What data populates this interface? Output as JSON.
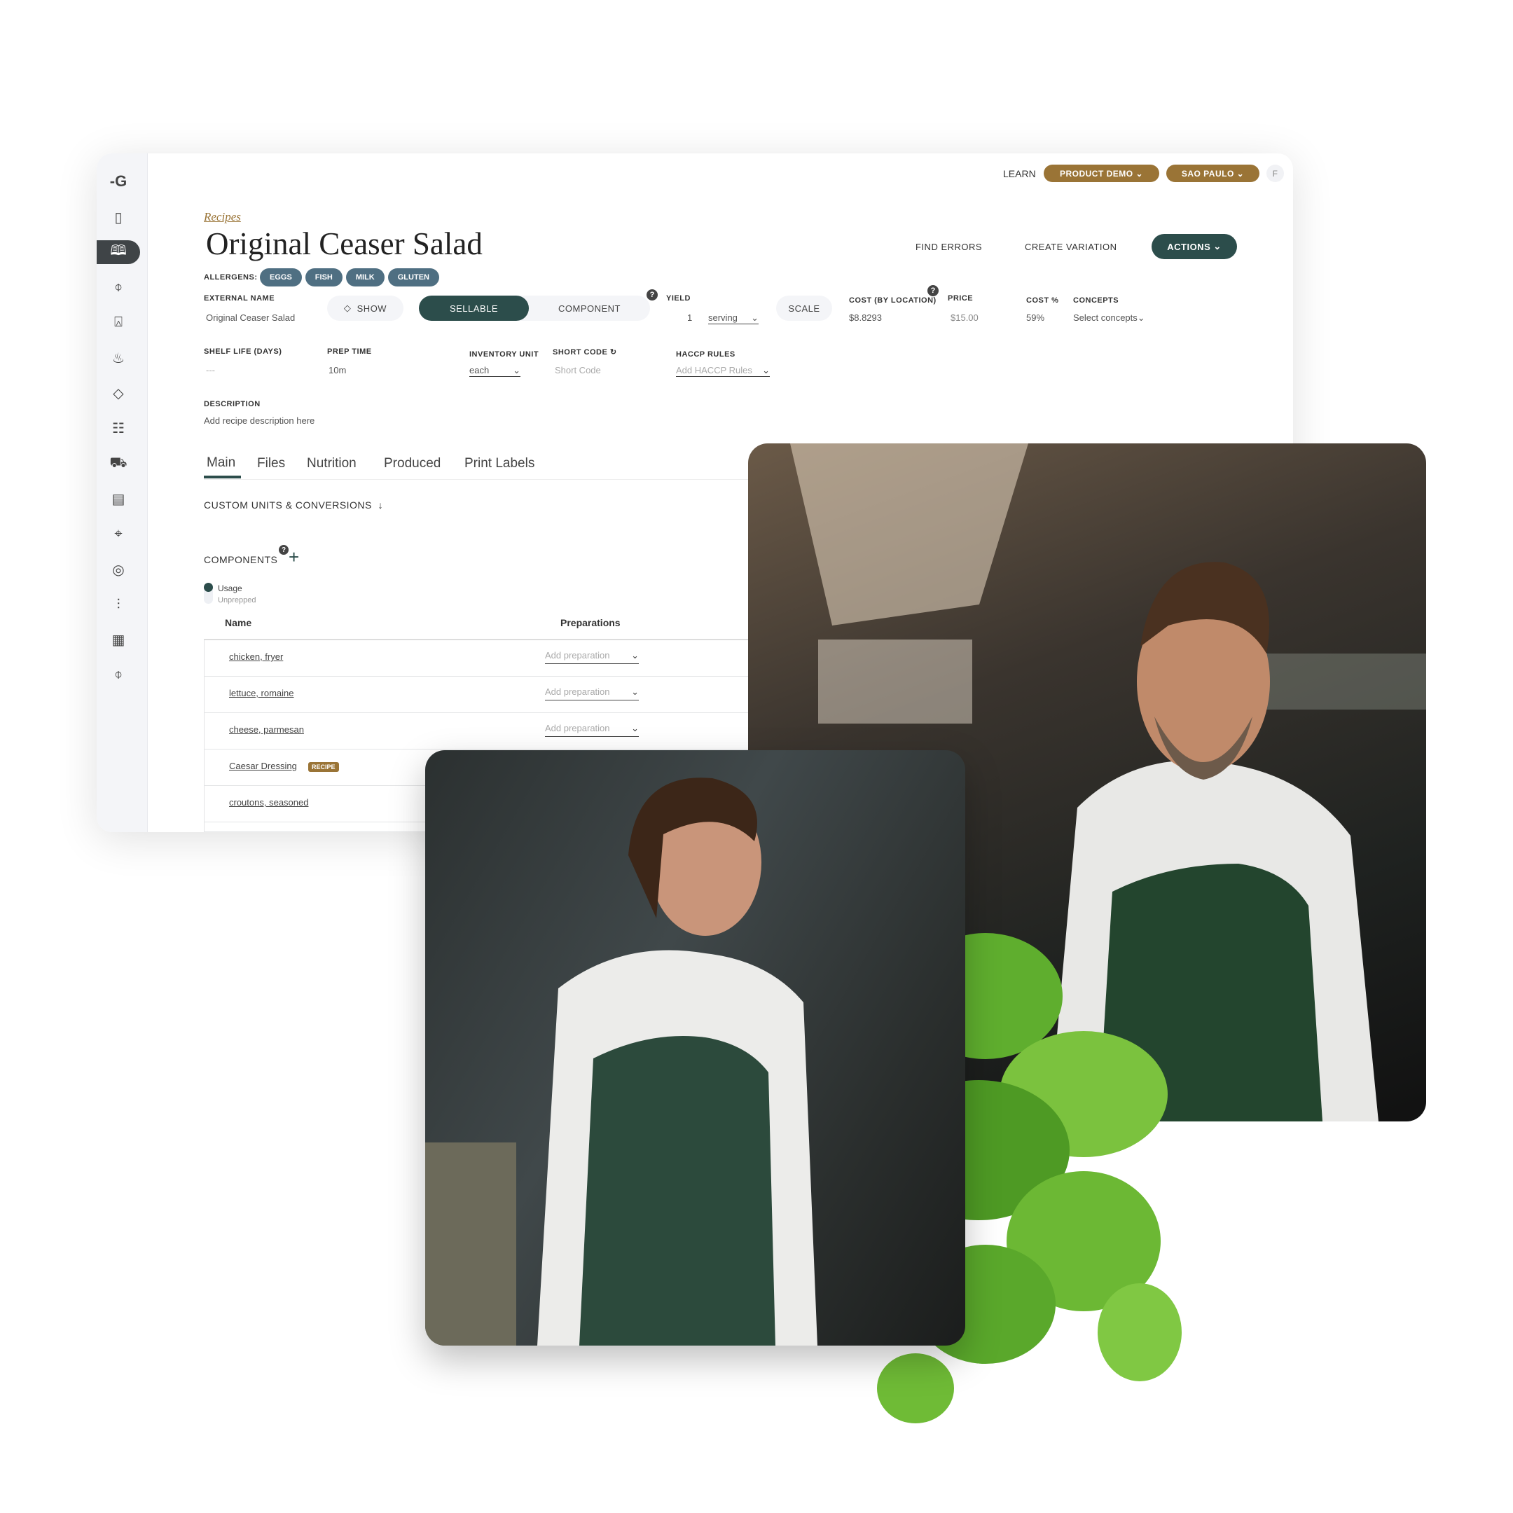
{
  "topbar": {
    "learn": "LEARN",
    "product_demo": "PRODUCT DEMO",
    "location": "SAO PAULO",
    "avatar": "F"
  },
  "breadcrumb": "Recipes",
  "title": "Original Ceaser Salad",
  "header_actions": {
    "find_errors": "FIND ERRORS",
    "create_variation": "CREATE VARIATION",
    "actions": "ACTIONS"
  },
  "allergens": {
    "label": "ALLERGENS:",
    "items": [
      "EGGS",
      "FISH",
      "MILK",
      "GLUTEN"
    ]
  },
  "fields": {
    "external_name": {
      "label": "EXTERNAL NAME",
      "value": "Original Ceaser Salad"
    },
    "show": "SHOW",
    "toggle": {
      "selected": "SELLABLE",
      "other": "COMPONENT"
    },
    "yield": {
      "label": "YIELD",
      "qty": "1",
      "unit": "serving"
    },
    "scale": "SCALE",
    "cost": {
      "label": "COST (BY LOCATION)",
      "value": "$8.8293"
    },
    "price": {
      "label": "PRICE",
      "value": "$15.00"
    },
    "cost_pct": {
      "label": "COST %",
      "value": "59%"
    },
    "concepts": {
      "label": "CONCEPTS",
      "placeholder": "Select concepts"
    },
    "shelf_life": {
      "label": "SHELF LIFE (DAYS)",
      "value": "---"
    },
    "prep_time": {
      "label": "PREP TIME",
      "value": "10m"
    },
    "inventory_unit": {
      "label": "INVENTORY UNIT",
      "value": "each"
    },
    "short_code": {
      "label": "SHORT CODE",
      "placeholder": "Short Code"
    },
    "haccp": {
      "label": "HACCP RULES",
      "placeholder": "Add HACCP Rules"
    },
    "description": {
      "label": "DESCRIPTION",
      "placeholder": "Add recipe description here"
    }
  },
  "tabs": [
    "Main",
    "Files",
    "Nutrition",
    "Produced",
    "Print Labels"
  ],
  "active_tab": "Main",
  "custom_units": "CUSTOM UNITS & CONVERSIONS",
  "components": {
    "title": "COMPONENTS",
    "legend": [
      "Usage",
      "Unprepped"
    ],
    "columns": [
      "Name",
      "Preparations"
    ],
    "rows": [
      {
        "name": "chicken, fryer",
        "prep": "Add preparation"
      },
      {
        "name": "lettuce, romaine",
        "prep": "Add preparation"
      },
      {
        "name": "cheese, parmesan",
        "prep": "Add preparation"
      },
      {
        "name": "Caesar Dressing",
        "badge": "RECIPE"
      },
      {
        "name": "croutons, seasoned"
      }
    ]
  },
  "colors": {
    "gold": "#9a7436",
    "dark_teal": "#2c4d4b",
    "allergen": "#4f6f82"
  }
}
